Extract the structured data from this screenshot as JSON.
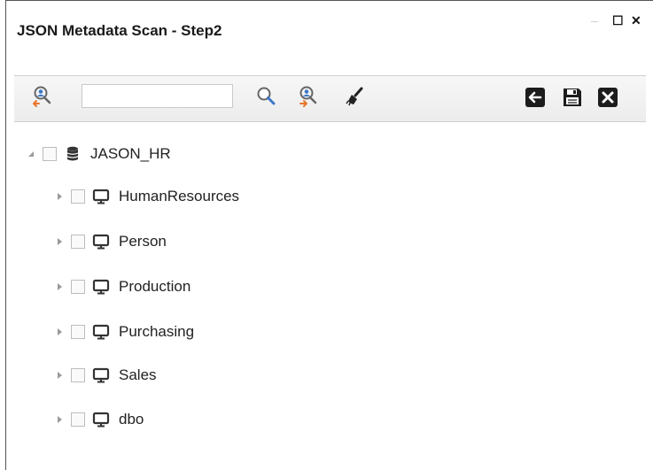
{
  "window": {
    "title": "JSON Metadata Scan - Step2",
    "maximize_glyph": "☐",
    "close_glyph": "✕"
  },
  "toolbar": {
    "search_placeholder": "",
    "search_value": "",
    "icons": [
      "user-search-left-icon",
      "search-icon",
      "user-search-right-icon",
      "clear-brush-icon",
      "back-arrow-icon",
      "save-icon",
      "close-box-icon"
    ]
  },
  "tree": {
    "root": {
      "label": "JASON_HR",
      "icon": "database-icon",
      "expanded": true,
      "checked": false
    },
    "children": [
      {
        "label": "HumanResources",
        "icon": "monitor-icon",
        "expanded": false,
        "checked": false
      },
      {
        "label": "Person",
        "icon": "monitor-icon",
        "expanded": false,
        "checked": false
      },
      {
        "label": "Production",
        "icon": "monitor-icon",
        "expanded": false,
        "checked": false
      },
      {
        "label": "Purchasing",
        "icon": "monitor-icon",
        "expanded": false,
        "checked": false
      },
      {
        "label": "Sales",
        "icon": "monitor-icon",
        "expanded": false,
        "checked": false
      },
      {
        "label": "dbo",
        "icon": "monitor-icon",
        "expanded": false,
        "checked": false
      }
    ]
  },
  "colors": {
    "accent_orange": "#e8762b",
    "icon_blue": "#3c77c9",
    "icon_dark": "#222222"
  }
}
